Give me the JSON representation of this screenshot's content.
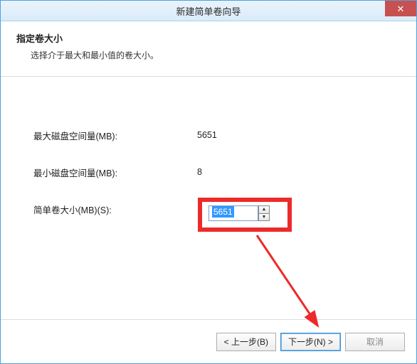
{
  "window": {
    "title": "新建简单卷向导"
  },
  "header": {
    "heading": "指定卷大小",
    "subheading": "选择介于最大和最小值的卷大小。"
  },
  "fields": {
    "max_label": "最大磁盘空间量(MB):",
    "max_value": "5651",
    "min_label": "最小磁盘空间量(MB):",
    "min_value": "8",
    "size_label": "简单卷大小(MB)(S):",
    "size_value": "5651"
  },
  "footer": {
    "back": "< 上一步(B)",
    "next": "下一步(N) >",
    "cancel": "取消"
  }
}
